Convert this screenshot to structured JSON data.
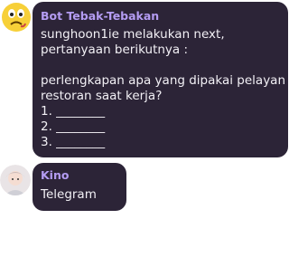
{
  "messages": [
    {
      "sender": "Bot Tebak-Tebakan",
      "avatar_icon": "emoji-face-icon",
      "text": "sunghoon1ie melakukan next,\npertanyaan berikutnya :\n\nperlengkapan apa yang dipakai pelayan\nrestoran saat kerja?\n1. ________\n2. ________\n3. ________"
    },
    {
      "sender": "Kino",
      "avatar_icon": "user-avatar-icon",
      "text": "Telegram"
    }
  ],
  "colors": {
    "bubble_bg": "#2c2437",
    "sender_name": "#b49cf2",
    "message_text": "#f2f0f5"
  }
}
